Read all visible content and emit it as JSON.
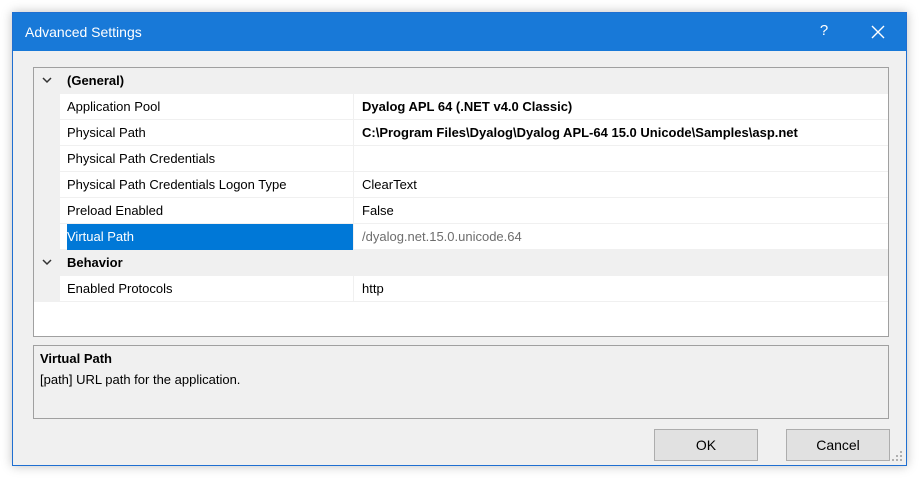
{
  "window": {
    "title": "Advanced Settings",
    "help_label": "?",
    "accent_color": "#1879d8"
  },
  "grid": {
    "categories": [
      {
        "name": "(General)",
        "properties": [
          {
            "name": "Application Pool",
            "value": "Dyalog APL 64 (.NET v4.0 Classic)",
            "bold": true
          },
          {
            "name": "Physical Path",
            "value": "C:\\Program Files\\Dyalog\\Dyalog APL-64 15.0 Unicode\\Samples\\asp.net",
            "bold": true
          },
          {
            "name": "Physical Path Credentials",
            "value": ""
          },
          {
            "name": "Physical Path Credentials Logon Type",
            "value": "ClearText"
          },
          {
            "name": "Preload Enabled",
            "value": "False"
          },
          {
            "name": "Virtual Path",
            "value": "/dyalog.net.15.0.unicode.64",
            "selected": true,
            "readonly": true
          }
        ]
      },
      {
        "name": "Behavior",
        "properties": [
          {
            "name": "Enabled Protocols",
            "value": "http"
          }
        ]
      }
    ],
    "selected_color": "#0078d7"
  },
  "description": {
    "title": "Virtual Path",
    "text": "[path] URL path for the application."
  },
  "buttons": {
    "ok_label": "OK",
    "cancel_label": "Cancel"
  }
}
